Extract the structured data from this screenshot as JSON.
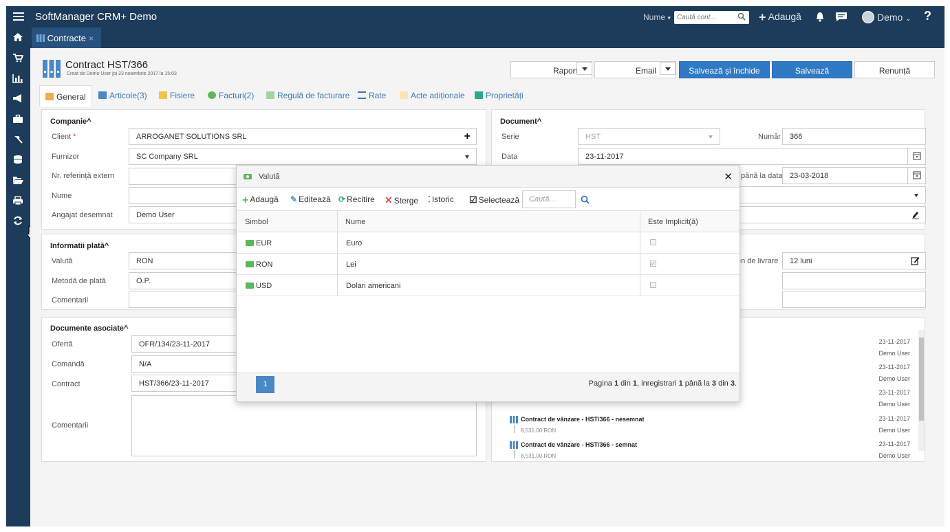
{
  "app": {
    "title": "SoftManager CRM+ Demo"
  },
  "topbar": {
    "search_label": "Nume",
    "search_placeholder": "Caută cont...",
    "add_label": "Adaugă",
    "user_name": "Demo",
    "help": "?"
  },
  "doc_tab": {
    "label": "Contracte",
    "close": "×"
  },
  "header": {
    "title": "Contract HST/366",
    "subtitle": "Creat de Demo User joi 23 noiembrie 2017 la 15:03"
  },
  "actions": {
    "raport": "Raport",
    "email": "Email",
    "save_close": "Salvează și închide",
    "save": "Salvează",
    "cancel": "Renunță"
  },
  "tabs": [
    {
      "label": "General"
    },
    {
      "label": "Articole(3)"
    },
    {
      "label": "Fisiere"
    },
    {
      "label": "Facturi(2)"
    },
    {
      "label": "Regulă de facturare"
    },
    {
      "label": "Rate"
    },
    {
      "label": "Acte adiționale"
    },
    {
      "label": "Proprietăți"
    }
  ],
  "companie": {
    "title": "Companie",
    "client_label": "Client",
    "client_value": "ARROGANET SOLUTIONS SRL",
    "furnizor_label": "Furnizor",
    "furnizor_value": "SC Company SRL",
    "ref_label": "Nr. referință extern",
    "nume_label": "Nume",
    "angajat_label": "Angajat desemnat",
    "angajat_value": "Demo User"
  },
  "document": {
    "title": "Document",
    "serie_label": "Serie",
    "serie_value": "HST",
    "numar_label": "Număr",
    "numar_value": "366",
    "data_label": "Data",
    "data_value": "23-11-2017",
    "pana_label": "până la data",
    "pana_value": "23-03-2018",
    "livrare_label": "en de livrare",
    "livrare_value": "12 luni"
  },
  "plata": {
    "title": "Informatii plată",
    "valuta_label": "Valută",
    "valuta_value": "RON",
    "metoda_label": "Metodă de plată",
    "metoda_value": "O.P.",
    "comentarii_label": "Comentarii"
  },
  "asociate": {
    "title": "Documente asociate",
    "oferta_label": "Ofertă",
    "oferta_value": "OFR/134/23-11-2017",
    "comanda_label": "Comandă",
    "comanda_value": "N/A",
    "contract_label": "Contract",
    "contract_value": "HST/366/23-11-2017",
    "comentarii_label": "Comentarii"
  },
  "history": [
    {
      "date": "23-11-2017",
      "user": "Demo User"
    },
    {
      "date": "23-11-2017",
      "user": "Demo User"
    },
    {
      "date": "23-11-2017",
      "user": "Demo User"
    },
    {
      "title": "Contract de vânzare - HST/366 - nesemnat",
      "amount": "8,531.00 RON",
      "date": "23-11-2017",
      "user": "Demo User"
    },
    {
      "title": "Contract de vânzare - HST/366 - semnat",
      "amount": "8,531.00 RON",
      "date": "23-11-2017",
      "user": "Demo User"
    }
  ],
  "modal": {
    "title": "Valută",
    "toolbar": {
      "add": "Adaugă",
      "edit": "Editează",
      "reload": "Recitire",
      "delete": "Sterge",
      "history": "Istoric",
      "select": "Selectează",
      "search_placeholder": "Caută..."
    },
    "columns": [
      "Simbol",
      "Nume",
      "Este Implicit(ă)"
    ],
    "rows": [
      {
        "symbol": "EUR",
        "name": "Euro",
        "default": false
      },
      {
        "symbol": "RON",
        "name": "Lei",
        "default": true
      },
      {
        "symbol": "USD",
        "name": "Dolari americani",
        "default": false
      }
    ],
    "pager": {
      "page": "1",
      "info_prefix": "Pagina ",
      "p1": "1",
      "din1": " din ",
      "p2": "1",
      "reg": ", inregistrari ",
      "r1": "1",
      "pana": " până la ",
      "r2": "3",
      "din2": " din ",
      "r3": "3",
      "dot": "."
    }
  },
  "colors": {
    "navy": "#1d3b5a",
    "tab_active": "#28527e",
    "primary": "#2f7ac4",
    "link": "#3a7ab8",
    "money": "#5cb85c"
  }
}
